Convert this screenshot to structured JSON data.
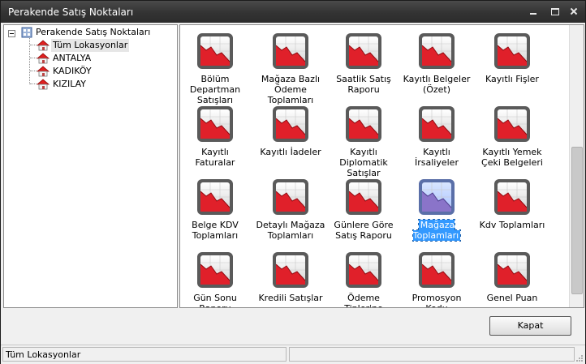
{
  "window": {
    "title": "Perakende Satış Noktaları"
  },
  "tree": {
    "root_label": "Perakende Satış Noktaları",
    "items": [
      {
        "label": "Tüm Lokasyonlar",
        "selected": true
      },
      {
        "label": "ANTALYA",
        "selected": false
      },
      {
        "label": "KADIKÖY",
        "selected": false
      },
      {
        "label": "KIZILAY",
        "selected": false
      }
    ]
  },
  "reports": [
    {
      "label": "Bölüm Departman Satışları"
    },
    {
      "label": "Mağaza Bazlı Ödeme Toplamları"
    },
    {
      "label": "Saatlik Satış Raporu"
    },
    {
      "label": "Kayıtlı Belgeler (Özet)"
    },
    {
      "label": "Kayıtlı Fişler"
    },
    {
      "label": "Kayıtlı Faturalar"
    },
    {
      "label": "Kayıtlı İadeler"
    },
    {
      "label": "Kayıtlı Diplomatik Satışlar"
    },
    {
      "label": "Kayıtlı İrsaliyeler"
    },
    {
      "label": "Kayıtlı Yemek Çeki Belgeleri"
    },
    {
      "label": "Belge KDV Toplamları"
    },
    {
      "label": "Detaylı Mağaza Toplamları"
    },
    {
      "label": "Günlere Göre Satış Raporu"
    },
    {
      "label": "Mağaza Toplamları",
      "selected": true
    },
    {
      "label": "Kdv Toplamları"
    },
    {
      "label": "Gün Sonu Raporu"
    },
    {
      "label": "Kredili Satışlar"
    },
    {
      "label": "Ödeme Tiplerine"
    },
    {
      "label": "Promosyon Kodu"
    },
    {
      "label": "Genel Puan"
    }
  ],
  "buttons": {
    "close_label": "Kapat"
  },
  "status": {
    "left_text": "Tüm Lokasyonlar",
    "middle_text": "",
    "right_text": ""
  },
  "icons": {
    "tree_root": "network-icon",
    "tree_item": "house-icon",
    "report": "report-chart-icon"
  },
  "colors": {
    "title_bar": "#333333",
    "selection": "#3399ff",
    "report_red": "#e0202a"
  }
}
